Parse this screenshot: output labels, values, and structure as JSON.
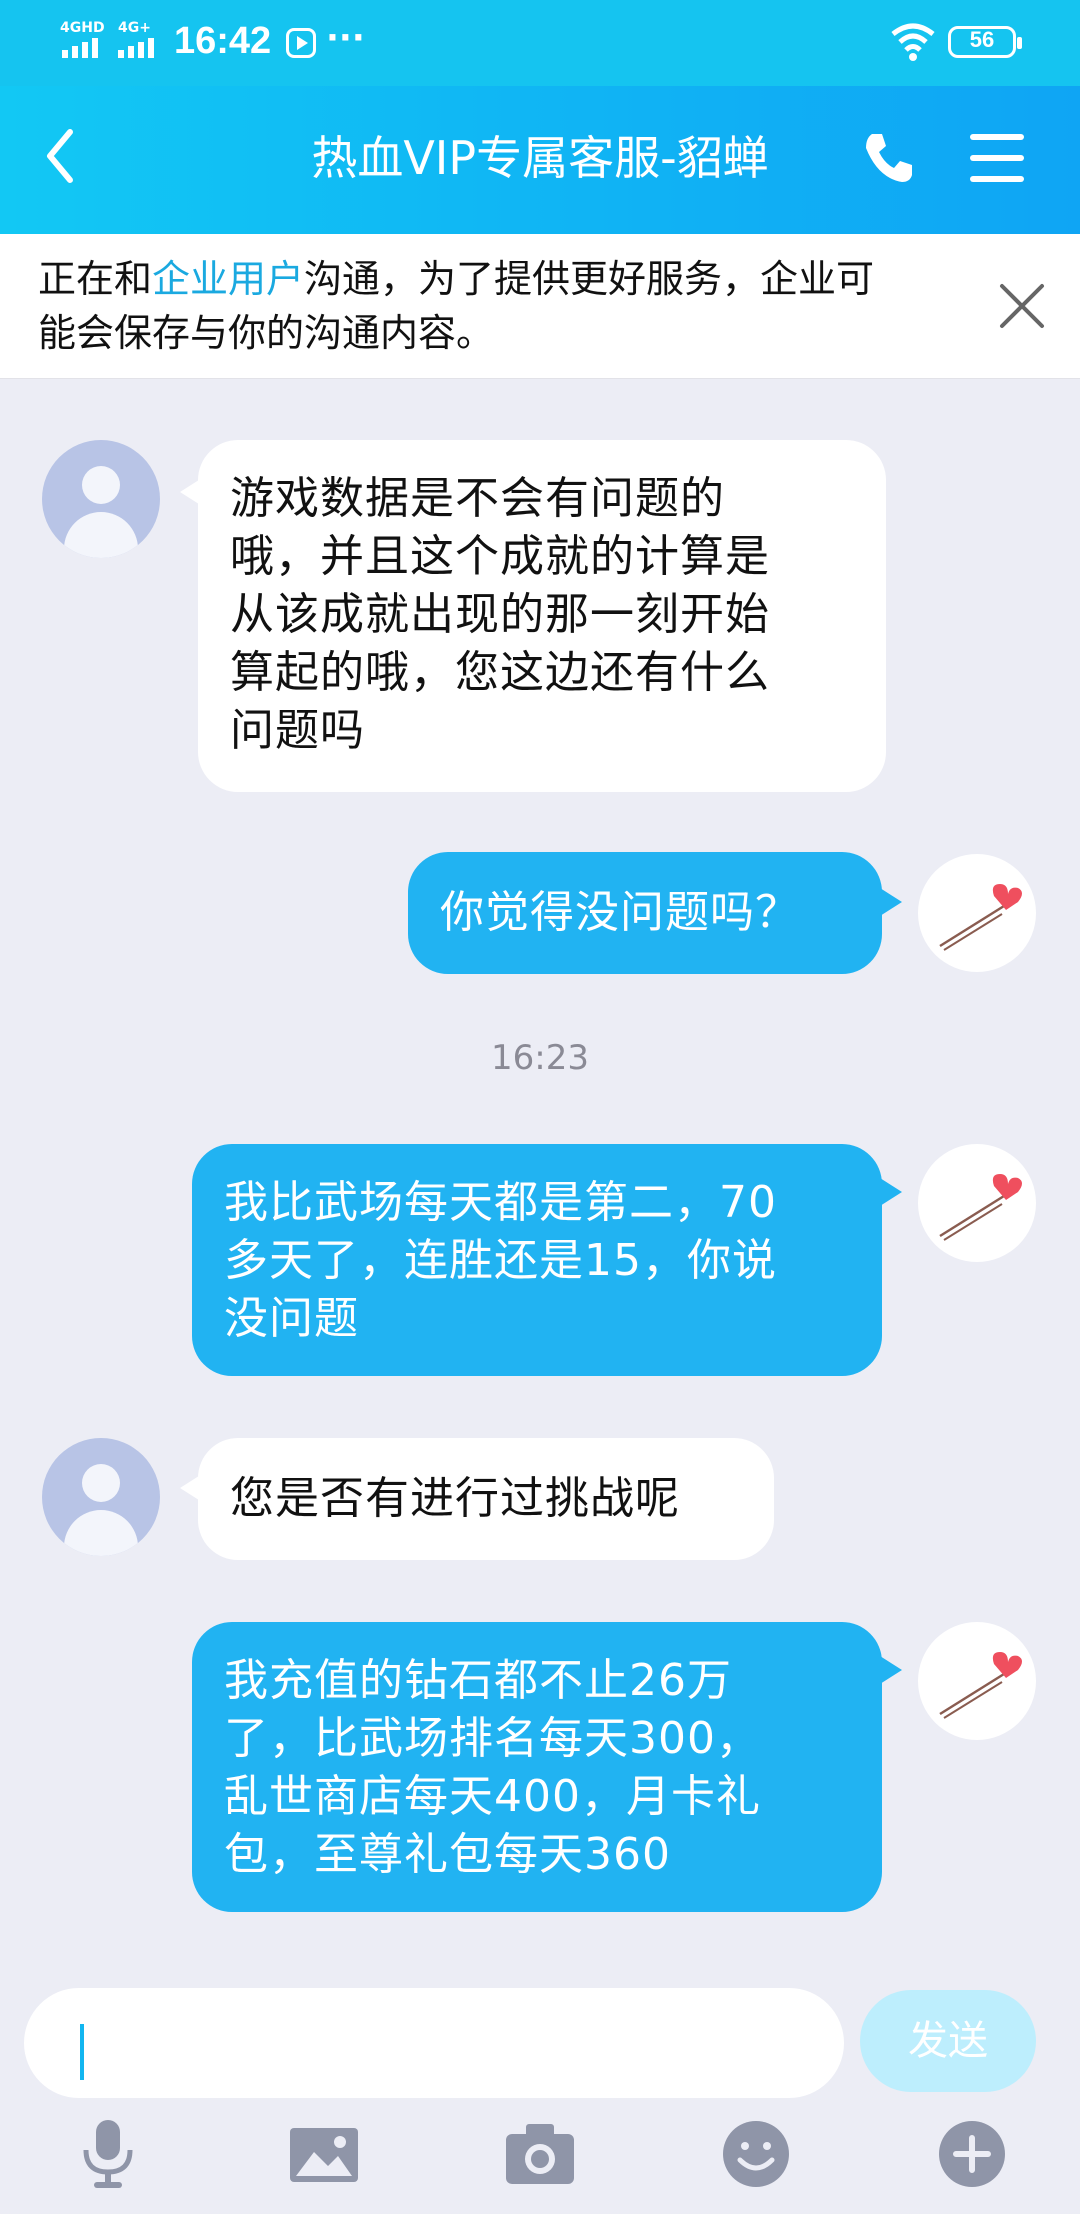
{
  "status_bar": {
    "signal1": "4GHD",
    "signal2": "4G+",
    "time": "16:42",
    "more": "···",
    "battery": "56"
  },
  "header": {
    "title": "热血VIP专属客服-貂蝉"
  },
  "notice": {
    "text_before": "正在和",
    "link": "企业用户",
    "text_after_line1": "沟通，为了提供更好服务，企业可",
    "text_line2": "能会保存与你的沟通内容。"
  },
  "messages": [
    {
      "side": "in",
      "text": "游戏数据是不会有问题的\n哦，并且这个成就的计算是\n从该成就出现的那一刻开始\n算起的哦，您这边还有什么\n问题吗"
    },
    {
      "side": "out",
      "text": "你觉得没问题吗？"
    },
    {
      "side": "out",
      "text": "我比武场每天都是第二，70\n多天了，连胜还是15，你说\n没问题"
    },
    {
      "side": "in",
      "text": "您是否有进行过挑战呢"
    },
    {
      "side": "out",
      "text": "我充值的钻石都不止26万\n了，比武场排名每天300，\n乱世商店每天400，月卡礼\n包，至尊礼包每天360"
    }
  ],
  "timestamp": "16:23",
  "input": {
    "send_label": "发送"
  },
  "colors": {
    "header": "#12c8f4",
    "bubble_out": "#21b3f2",
    "link": "#1aa9e0"
  }
}
